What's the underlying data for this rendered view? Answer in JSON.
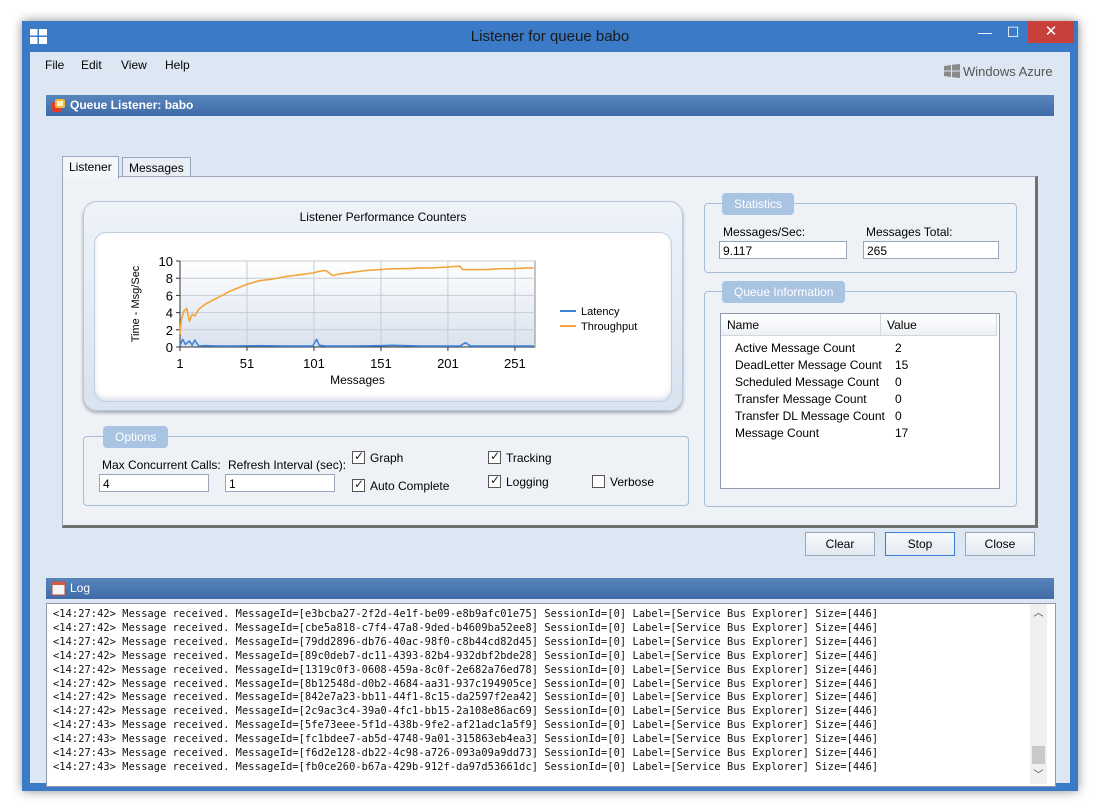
{
  "window": {
    "title": "Listener for queue babo",
    "min_glyph": "—",
    "max_glyph": "☐",
    "close_glyph": "✕"
  },
  "menu": {
    "items": [
      "File",
      "Edit",
      "View",
      "Help"
    ]
  },
  "branding": {
    "text": "Windows Azure"
  },
  "queue_header": {
    "title": "Queue Listener: babo"
  },
  "tabs": [
    {
      "label": "Listener",
      "active": true
    },
    {
      "label": "Messages",
      "active": false
    }
  ],
  "chart_data": {
    "type": "line",
    "title": "Listener Performance Counters",
    "xlabel": "Messages",
    "ylabel": "Time - Msg/Sec",
    "x_ticks": [
      "1",
      "51",
      "101",
      "151",
      "201",
      "251"
    ],
    "y_ticks": [
      "0",
      "2",
      "4",
      "6",
      "8",
      "10"
    ],
    "xlim": [
      1,
      266
    ],
    "ylim": [
      0,
      10
    ],
    "grid": true,
    "legend": "right",
    "series": [
      {
        "name": "Latency",
        "color": "#3f84d8",
        "x": [
          1,
          3,
          5,
          8,
          10,
          12,
          15,
          20,
          30,
          40,
          60,
          80,
          100,
          103,
          105,
          110,
          130,
          150,
          160,
          180,
          200,
          210,
          214,
          218,
          230,
          250,
          265
        ],
        "y": [
          0.2,
          0.9,
          0.3,
          0.7,
          0.2,
          0.8,
          0.1,
          0.15,
          0.1,
          0.1,
          0.15,
          0.1,
          0.1,
          0.9,
          0.2,
          0.1,
          0.1,
          0.15,
          0.2,
          0.1,
          0.1,
          0.1,
          0.5,
          0.1,
          0.1,
          0.1,
          0.1
        ]
      },
      {
        "name": "Throughput",
        "color": "#f3a43a",
        "x": [
          1,
          2,
          4,
          6,
          8,
          10,
          12,
          15,
          20,
          30,
          40,
          51,
          60,
          70,
          80,
          90,
          100,
          105,
          110,
          115,
          120,
          130,
          140,
          150,
          160,
          170,
          180,
          190,
          200,
          210,
          212,
          220,
          230,
          240,
          250,
          260,
          265
        ],
        "y": [
          1.5,
          3.2,
          4.2,
          4.5,
          3.0,
          3.8,
          3.6,
          4.4,
          5.0,
          5.8,
          6.6,
          7.3,
          7.7,
          7.9,
          8.2,
          8.4,
          8.6,
          8.8,
          8.9,
          8.3,
          8.5,
          8.7,
          8.9,
          9.0,
          9.1,
          9.1,
          9.2,
          9.2,
          9.3,
          9.4,
          9.0,
          9.0,
          9.0,
          9.1,
          9.1,
          9.2,
          9.2
        ]
      }
    ]
  },
  "statistics": {
    "title": "Statistics",
    "messages_per_sec_label": "Messages/Sec:",
    "messages_per_sec_value": "9.117",
    "messages_total_label": "Messages Total:",
    "messages_total_value": "265"
  },
  "queue_info": {
    "title": "Queue Information",
    "columns": [
      "Name",
      "Value"
    ],
    "rows": [
      {
        "name": "Active Message Count",
        "value": "2"
      },
      {
        "name": "DeadLetter Message Count",
        "value": "15"
      },
      {
        "name": "Scheduled Message Count",
        "value": "0"
      },
      {
        "name": "Transfer Message Count",
        "value": "0"
      },
      {
        "name": "Transfer DL Message Count",
        "value": "0"
      },
      {
        "name": "Message Count",
        "value": "17"
      }
    ]
  },
  "options": {
    "title": "Options",
    "max_calls_label": "Max Concurrent Calls:",
    "max_calls_value": "4",
    "refresh_label": "Refresh Interval (sec):",
    "refresh_value": "1",
    "graph_label": "Graph",
    "graph_checked": true,
    "autocomplete_label": "Auto Complete",
    "autocomplete_checked": true,
    "tracking_label": "Tracking",
    "tracking_checked": true,
    "logging_label": "Logging",
    "logging_checked": true,
    "verbose_label": "Verbose",
    "verbose_checked": false
  },
  "buttons": {
    "clear": "Clear",
    "stop": "Stop",
    "close": "Close"
  },
  "log": {
    "title": "Log",
    "lines": [
      "<14:27:42> Message received. MessageId=[e3bcba27-2f2d-4e1f-be09-e8b9afc01e75] SessionId=[0] Label=[Service Bus Explorer] Size=[446]",
      "<14:27:42> Message received. MessageId=[cbe5a818-c7f4-47a8-9ded-b4609ba52ee8] SessionId=[0] Label=[Service Bus Explorer] Size=[446]",
      "<14:27:42> Message received. MessageId=[79dd2896-db76-40ac-98f0-c8b44cd82d45] SessionId=[0] Label=[Service Bus Explorer] Size=[446]",
      "<14:27:42> Message received. MessageId=[89c0deb7-dc11-4393-82b4-932dbf2bde28] SessionId=[0] Label=[Service Bus Explorer] Size=[446]",
      "<14:27:42> Message received. MessageId=[1319c0f3-0608-459a-8c0f-2e682a76ed78] SessionId=[0] Label=[Service Bus Explorer] Size=[446]",
      "<14:27:42> Message received. MessageId=[8b12548d-d0b2-4684-aa31-937c194905ce] SessionId=[0] Label=[Service Bus Explorer] Size=[446]",
      "<14:27:42> Message received. MessageId=[842e7a23-bb11-44f1-8c15-da2597f2ea42] SessionId=[0] Label=[Service Bus Explorer] Size=[446]",
      "<14:27:42> Message received. MessageId=[2c9ac3c4-39a0-4fc1-bb15-2a108e86ac69] SessionId=[0] Label=[Service Bus Explorer] Size=[446]",
      "<14:27:43> Message received. MessageId=[5fe73eee-5f1d-438b-9fe2-af21adc1a5f9] SessionId=[0] Label=[Service Bus Explorer] Size=[446]",
      "<14:27:43> Message received. MessageId=[fc1bdee7-ab5d-4748-9a01-315863eb4ea3] SessionId=[0] Label=[Service Bus Explorer] Size=[446]",
      "<14:27:43> Message received. MessageId=[f6d2e128-db22-4c98-a726-093a09a9dd73] SessionId=[0] Label=[Service Bus Explorer] Size=[446]",
      "<14:27:43> Message received. MessageId=[fb0ce260-b67a-429b-912f-da97d53661dc] SessionId=[0] Label=[Service Bus Explorer] Size=[446]"
    ]
  }
}
